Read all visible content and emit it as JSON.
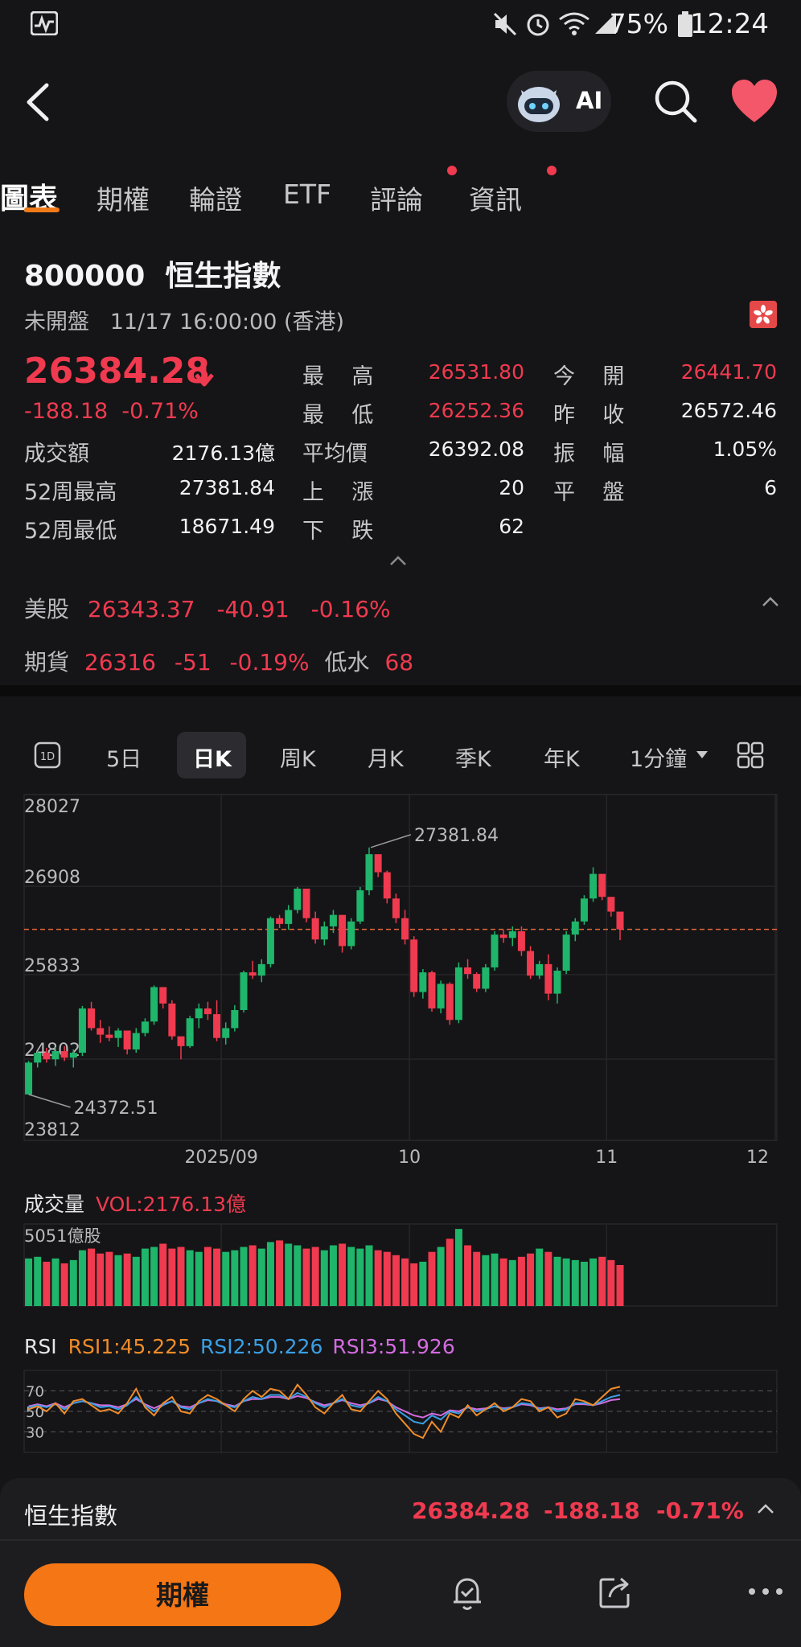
{
  "status_bar": {
    "battery": "75%",
    "time": "12:24",
    "icons": [
      "activity-icon",
      "mute-icon",
      "alarm-icon",
      "wifi-icon",
      "signal-icon",
      "battery-icon"
    ]
  },
  "header": {
    "ai_label": "AI"
  },
  "tabs": [
    {
      "label": "圖表",
      "active": true,
      "dot": false
    },
    {
      "label": "期權",
      "active": false,
      "dot": false
    },
    {
      "label": "輪證",
      "active": false,
      "dot": false
    },
    {
      "label": "ETF",
      "active": false,
      "dot": false
    },
    {
      "label": "評論",
      "active": false,
      "dot": true
    },
    {
      "label": "資訊",
      "active": false,
      "dot": true
    }
  ],
  "quote": {
    "title": "800000  恒生指數",
    "session": "未開盤   11/17 16:00:00 (香港)",
    "price": "26384.28",
    "change": "-188.18  -0.71%",
    "stats": [
      {
        "label": "最    高",
        "value": "26531.80",
        "color": "#f03a4f"
      },
      {
        "label": "今    開",
        "value": "26441.70",
        "color": "#f03a4f"
      },
      {
        "label": "最    低",
        "value": "26252.36",
        "color": "#f03a4f"
      },
      {
        "label": "昨    收",
        "value": "26572.46",
        "color": "#f2f2f4"
      },
      {
        "label": "成交額",
        "value": "2176.13億",
        "color": "#f2f2f4"
      },
      {
        "label": "平均價",
        "value": "26392.08",
        "color": "#f2f2f4"
      },
      {
        "label": "振    幅",
        "value": "1.05%",
        "color": "#f2f2f4"
      },
      {
        "label": "52周最高",
        "value": "27381.84",
        "color": "#f2f2f4"
      },
      {
        "label": "上    漲",
        "value": "20",
        "color": "#f2f2f4"
      },
      {
        "label": "平    盤",
        "value": "6",
        "color": "#f2f2f4"
      },
      {
        "label": "52周最低",
        "value": "18671.49",
        "color": "#f2f2f4"
      },
      {
        "label": "下    跌",
        "value": "62",
        "color": "#f2f2f4"
      }
    ]
  },
  "us_market": {
    "label": "美股",
    "price": "26343.37",
    "change": "-40.91",
    "pct": "-0.16%"
  },
  "futures": {
    "label": "期貨",
    "price": "26316",
    "change": "-51",
    "pct": "-0.19%",
    "basis_label": "低水",
    "basis": "68"
  },
  "period_tabs": [
    {
      "label": "5日",
      "active": false
    },
    {
      "label": "日K",
      "active": true
    },
    {
      "label": "周K",
      "active": false
    },
    {
      "label": "月K",
      "active": false
    },
    {
      "label": "季K",
      "active": false
    },
    {
      "label": "年K",
      "active": false
    },
    {
      "label": "1分鐘",
      "active": false
    }
  ],
  "chart": {
    "y_ticks": [
      "28027",
      "26908",
      "25833",
      "24802",
      "23812"
    ],
    "x_ticks": [
      "2025/09",
      "10",
      "11",
      "12"
    ],
    "high_label": "27381.84",
    "low_label": "24372.51"
  },
  "chart_data": {
    "type": "candlestick",
    "last_close": 26384.28,
    "ylim": [
      23812,
      28027
    ],
    "series": [
      {
        "name": "daily",
        "ohlc": [
          [
            24372,
            24780,
            24372,
            24760
          ],
          [
            24760,
            24900,
            24700,
            24880
          ],
          [
            24880,
            24940,
            24760,
            24800
          ],
          [
            24800,
            24950,
            24720,
            24900
          ],
          [
            24900,
            24960,
            24780,
            24820
          ],
          [
            24820,
            24920,
            24700,
            24880
          ],
          [
            24880,
            25450,
            24840,
            25420
          ],
          [
            25420,
            25500,
            25150,
            25180
          ],
          [
            25180,
            25280,
            25000,
            25100
          ],
          [
            25100,
            25200,
            25020,
            25060
          ],
          [
            25060,
            25180,
            24950,
            25150
          ],
          [
            25150,
            25120,
            24860,
            24920
          ],
          [
            24920,
            25180,
            24880,
            25120
          ],
          [
            25120,
            25300,
            25080,
            25260
          ],
          [
            25260,
            25700,
            25220,
            25680
          ],
          [
            25680,
            25640,
            25420,
            25480
          ],
          [
            25480,
            25520,
            25040,
            25080
          ],
          [
            25080,
            25000,
            24800,
            24960
          ],
          [
            24960,
            25330,
            24940,
            25300
          ],
          [
            25300,
            25480,
            25180,
            25420
          ],
          [
            25420,
            25500,
            25280,
            25350
          ],
          [
            25350,
            25520,
            25020,
            25060
          ],
          [
            25060,
            25250,
            24980,
            25180
          ],
          [
            25180,
            25460,
            25140,
            25400
          ],
          [
            25400,
            25880,
            25370,
            25860
          ],
          [
            25860,
            26000,
            25780,
            25820
          ],
          [
            25820,
            26020,
            25740,
            25960
          ],
          [
            25960,
            26540,
            25920,
            26520
          ],
          [
            26520,
            26560,
            26400,
            26450
          ],
          [
            26450,
            26680,
            26380,
            26620
          ],
          [
            26620,
            26900,
            26580,
            26880
          ],
          [
            26880,
            26820,
            26470,
            26520
          ],
          [
            26520,
            26600,
            26210,
            26260
          ],
          [
            26260,
            26480,
            26190,
            26420
          ],
          [
            26420,
            26620,
            26340,
            26560
          ],
          [
            26560,
            26500,
            26100,
            26180
          ],
          [
            26180,
            26520,
            26140,
            26480
          ],
          [
            26480,
            26900,
            26450,
            26860
          ],
          [
            26860,
            27382,
            26800,
            27300
          ],
          [
            27300,
            27280,
            27020,
            27080
          ],
          [
            27080,
            27100,
            26700,
            26760
          ],
          [
            26760,
            26820,
            26460,
            26520
          ],
          [
            26520,
            26620,
            26200,
            26260
          ],
          [
            26260,
            26300,
            25560,
            25620
          ],
          [
            25620,
            25900,
            25540,
            25860
          ],
          [
            25860,
            25880,
            25380,
            25420
          ],
          [
            25420,
            25760,
            25360,
            25720
          ],
          [
            25720,
            25740,
            25220,
            25280
          ],
          [
            25280,
            25980,
            25240,
            25920
          ],
          [
            25920,
            26020,
            25780,
            25840
          ],
          [
            25840,
            25860,
            25620,
            25660
          ],
          [
            25660,
            25960,
            25620,
            25920
          ],
          [
            25920,
            26360,
            25880,
            26320
          ],
          [
            26320,
            26380,
            26220,
            26280
          ],
          [
            26280,
            26420,
            26180,
            26360
          ],
          [
            26360,
            26420,
            26060,
            26120
          ],
          [
            26120,
            26180,
            25780,
            25820
          ],
          [
            25820,
            26000,
            25780,
            25960
          ],
          [
            25960,
            26080,
            25520,
            25600
          ],
          [
            25600,
            25920,
            25480,
            25880
          ],
          [
            25880,
            26360,
            25840,
            26320
          ],
          [
            26320,
            26520,
            26240,
            26480
          ],
          [
            26480,
            26800,
            26440,
            26760
          ],
          [
            26760,
            27140,
            26720,
            27060
          ],
          [
            27060,
            27020,
            26740,
            26780
          ],
          [
            26780,
            26680,
            26540,
            26600
          ],
          [
            26600,
            26560,
            26252,
            26384
          ]
        ]
      },
      {
        "name": "vol",
        "values": [
          58,
          60,
          54,
          58,
          52,
          56,
          68,
          70,
          64,
          66,
          62,
          64,
          60,
          70,
          72,
          76,
          70,
          72,
          68,
          66,
          72,
          70,
          66,
          68,
          72,
          74,
          70,
          78,
          80,
          76,
          74,
          70,
          72,
          68,
          74,
          76,
          72,
          70,
          74,
          68,
          66,
          62,
          58,
          52,
          54,
          66,
          72,
          82,
          94,
          74,
          66,
          62,
          64,
          58,
          56,
          60,
          64,
          70,
          66,
          60,
          58,
          56,
          54,
          58,
          60,
          56,
          50,
          48
        ]
      },
      {
        "name": "RSI1:45.225",
        "values": [
          52,
          55,
          50,
          58,
          48,
          60,
          62,
          56,
          50,
          52,
          48,
          58,
          72,
          54,
          46,
          58,
          64,
          50,
          48,
          60,
          66,
          62,
          56,
          50,
          62,
          70,
          64,
          72,
          70,
          62,
          76,
          66,
          54,
          48,
          58,
          66,
          52,
          50,
          60,
          70,
          62,
          48,
          38,
          28,
          24,
          40,
          30,
          48,
          44,
          56,
          46,
          52,
          58,
          50,
          54,
          62,
          60,
          50,
          54,
          44,
          48,
          62,
          60,
          56,
          64,
          72,
          74,
          66,
          46
        ]
      },
      {
        "name": "RSI2:50.226",
        "values": [
          54,
          56,
          54,
          57,
          52,
          58,
          60,
          58,
          54,
          55,
          52,
          56,
          64,
          56,
          50,
          56,
          60,
          54,
          52,
          58,
          62,
          60,
          56,
          54,
          60,
          64,
          62,
          66,
          66,
          62,
          68,
          64,
          58,
          54,
          58,
          62,
          56,
          54,
          58,
          64,
          60,
          52,
          46,
          40,
          38,
          46,
          42,
          50,
          48,
          54,
          50,
          52,
          55,
          52,
          54,
          58,
          57,
          52,
          54,
          50,
          52,
          58,
          58,
          56,
          60,
          64,
          66,
          62,
          50
        ]
      },
      {
        "name": "RSI3:51.926",
        "values": [
          55,
          57,
          55,
          58,
          54,
          58,
          60,
          58,
          56,
          56,
          54,
          57,
          62,
          57,
          53,
          57,
          60,
          55,
          54,
          58,
          61,
          60,
          57,
          55,
          60,
          62,
          62,
          64,
          64,
          62,
          65,
          63,
          59,
          56,
          58,
          61,
          58,
          56,
          58,
          62,
          60,
          54,
          50,
          46,
          44,
          48,
          46,
          51,
          50,
          54,
          52,
          53,
          55,
          53,
          54,
          57,
          56,
          53,
          54,
          52,
          53,
          57,
          57,
          56,
          58,
          61,
          62,
          60,
          52
        ]
      }
    ]
  },
  "volume": {
    "title": "成交量",
    "vol_label": "VOL:2176.13億",
    "axis_max": "5051億股"
  },
  "rsi": {
    "title": "RSI",
    "rsi1": "RSI1:45.225",
    "rsi2": "RSI2:50.226",
    "rsi3": "RSI3:51.926",
    "levels": [
      "70",
      "50",
      "30"
    ],
    "colors": {
      "rsi1": "#f08c2a",
      "rsi2": "#3aa0e6",
      "rsi3": "#d46be0"
    }
  },
  "bottom_ticker": {
    "name": "恒生指數",
    "price": "26384.28",
    "change": "-188.18",
    "pct": "-0.71%"
  },
  "bottom_bar": {
    "options_button": "期權"
  },
  "colors": {
    "up": "#1fb56b",
    "down": "#f03a4f",
    "accent": "#f57614",
    "bg": "#151517"
  }
}
